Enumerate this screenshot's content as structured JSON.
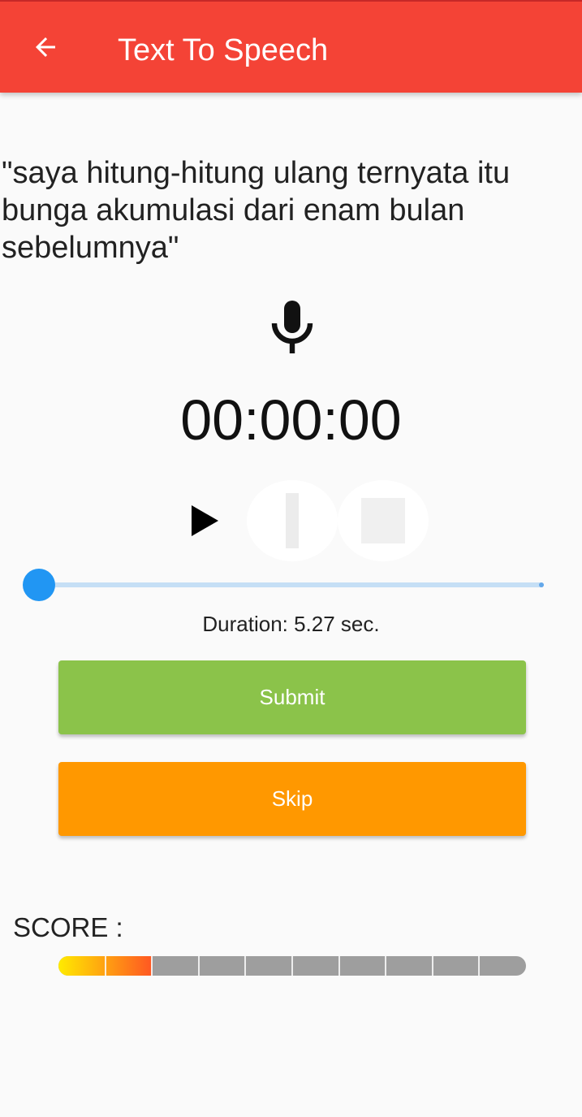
{
  "appbar": {
    "title": "Text To Speech",
    "back_icon": "arrow-back-icon",
    "color": "#f44336"
  },
  "sentence": "\"saya hitung-hitung ulang ternyata itu bunga akumulasi dari enam bulan sebelumnya\"",
  "recorder": {
    "mic_icon": "microphone-icon",
    "timer": "00:00:00",
    "controls": {
      "play_icon": "play-icon",
      "pause_icon": "pause-icon",
      "stop_icon": "stop-icon"
    },
    "playback_position": 0,
    "duration_label": "Duration: 5.27 sec.",
    "slider_color": "#2196f3"
  },
  "actions": {
    "submit_label": "Submit",
    "submit_color": "#8bc34a",
    "skip_label": "Skip",
    "skip_color": "#ff9800"
  },
  "score": {
    "label": "SCORE :",
    "segments_total": 10,
    "segments_filled": 2,
    "fill_colors": [
      "#ffeb00",
      "#ff5722"
    ],
    "empty_color": "#9e9e9e"
  }
}
